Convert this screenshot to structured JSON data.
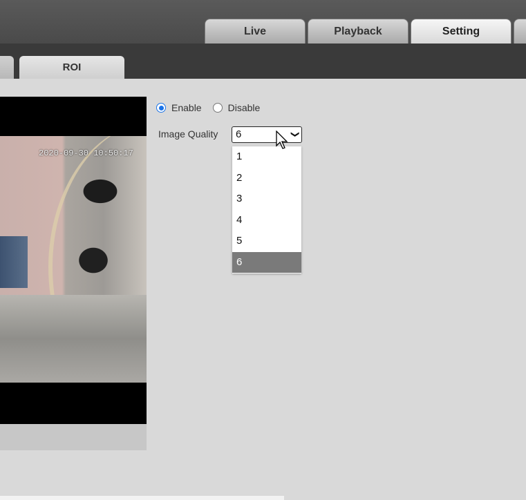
{
  "main_tabs": [
    "Live",
    "Playback",
    "Setting"
  ],
  "active_main_tab": "Setting",
  "sub_tab": {
    "label": "ROI"
  },
  "video": {
    "timestamp": "2020-09-30 10:50:17"
  },
  "roi": {
    "enable_label": "Enable",
    "disable_label": "Disable",
    "selected": "Enable",
    "image_quality_label": "Image Quality",
    "image_quality_value": "6",
    "options": [
      "1",
      "2",
      "3",
      "4",
      "5",
      "6"
    ]
  },
  "colors": {
    "accent": "#1a73e8",
    "highlight": "#7a7a7a"
  }
}
